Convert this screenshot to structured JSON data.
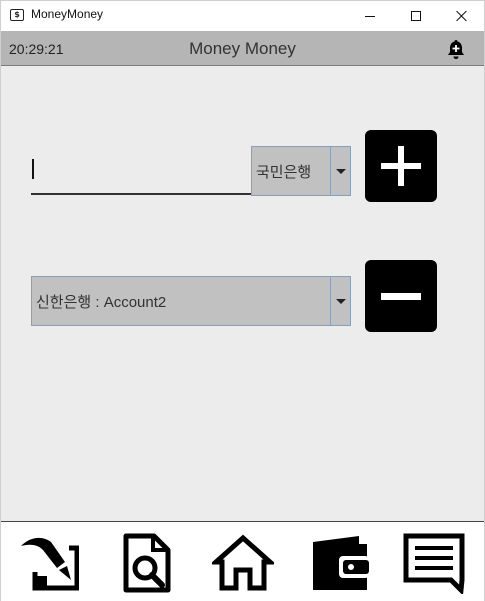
{
  "window": {
    "title": "MoneyMoney",
    "icon_glyph": "$",
    "icon": "app-money-icon"
  },
  "header": {
    "clock": "20:29:21",
    "title": "Money Money",
    "bell_icon": "bell-plus-icon"
  },
  "deposit": {
    "amount_value": "",
    "bank_selected": "국민은행",
    "add_icon": "plus-icon"
  },
  "withdraw": {
    "account_selected": "신한은행 : Account2",
    "remove_icon": "minus-icon"
  },
  "nav": {
    "items": [
      {
        "icon": "pen-chart-icon"
      },
      {
        "icon": "document-search-icon"
      },
      {
        "icon": "home-icon"
      },
      {
        "icon": "wallet-icon"
      },
      {
        "icon": "message-icon"
      }
    ]
  },
  "colors": {
    "header_bg": "#b5b5b5",
    "content_bg": "#ececec",
    "dropdown_bg": "#c1c1c1",
    "button_bg": "#000000"
  }
}
